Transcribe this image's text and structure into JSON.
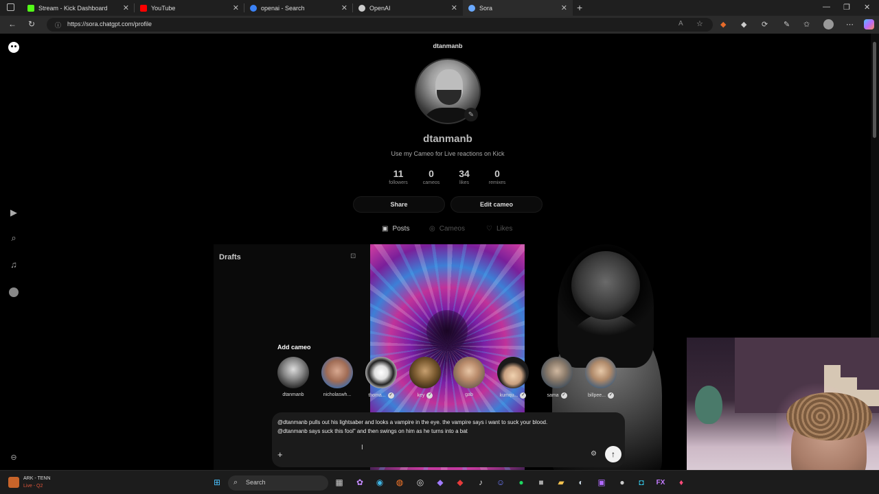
{
  "browser": {
    "tabs": [
      {
        "label": "Stream - Kick Dashboard",
        "fav_color": "#53fc18"
      },
      {
        "label": "YouTube",
        "fav_color": "#ff0000"
      },
      {
        "label": "openai - Search",
        "fav_color": "#3b82f6"
      },
      {
        "label": "OpenAI",
        "fav_color": "#cccccc"
      },
      {
        "label": "Sora",
        "fav_color": "#6aa9ff"
      }
    ],
    "url": "https://sora.chatgpt.com/profile"
  },
  "profile": {
    "top_username": "dtanmanb",
    "display_name": "dtanmanb",
    "bio": "Use my Cameo for Live reactions on Kick",
    "stats": [
      {
        "value": "11",
        "label": "followers"
      },
      {
        "value": "0",
        "label": "cameos"
      },
      {
        "value": "34",
        "label": "likes"
      },
      {
        "value": "0",
        "label": "remixes"
      }
    ],
    "share_label": "Share",
    "edit_cameo_label": "Edit cameo",
    "tabs": [
      {
        "label": "Posts",
        "icon": "play-square-icon",
        "active": true
      },
      {
        "label": "Cameos",
        "icon": "cameo-icon",
        "active": false
      },
      {
        "label": "Likes",
        "icon": "heart-icon",
        "active": false
      }
    ]
  },
  "drafts": {
    "title": "Drafts"
  },
  "cameo_picker": {
    "label": "Add cameo",
    "people": [
      {
        "name": "dtanmanb",
        "verified": false
      },
      {
        "name": "nicholaswh...",
        "verified": false
      },
      {
        "name": "thoma...",
        "verified": true
      },
      {
        "name": "key",
        "verified": true
      },
      {
        "name": "gab",
        "verified": false
      },
      {
        "name": "kumqu...",
        "verified": true
      },
      {
        "name": "sama",
        "verified": true
      },
      {
        "name": "billpee...",
        "verified": true
      }
    ]
  },
  "composer": {
    "prompt_line1": "@dtanmanb pulls out his lightsaber and looks a vampire in the eye. the vampire says i want to suck your blood.",
    "prompt_line2": "@dtanmanb says suck this fool\" and then swings on him as he turns into a bat"
  },
  "taskbar": {
    "game_title": "ARK - TENN",
    "game_subtitle": "Live - Q2",
    "search_placeholder": "Search"
  }
}
